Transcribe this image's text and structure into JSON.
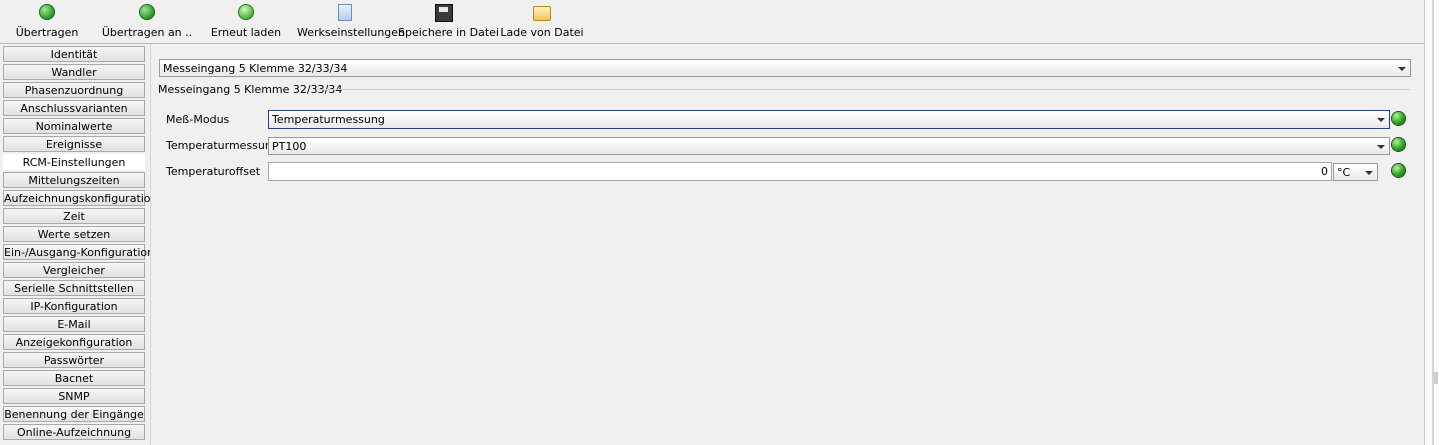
{
  "toolbar": {
    "buttons": [
      {
        "label": "Übertragen",
        "icon": "transfer-icon"
      },
      {
        "label": "Übertragen an ..",
        "icon": "transfer-to-icon"
      },
      {
        "label": "Erneut laden",
        "icon": "reload-icon"
      },
      {
        "label": "Werkseinstellungen",
        "icon": "factory-settings-icon"
      },
      {
        "label": "Speichere in Datei",
        "icon": "save-file-icon"
      },
      {
        "label": "Lade von Datei",
        "icon": "open-folder-icon"
      }
    ]
  },
  "sidebar": {
    "items": [
      {
        "label": "Identität"
      },
      {
        "label": "Wandler"
      },
      {
        "label": "Phasenzuordnung"
      },
      {
        "label": "Anschlussvarianten"
      },
      {
        "label": "Nominalwerte"
      },
      {
        "label": "Ereignisse"
      },
      {
        "label": "RCM-Einstellungen"
      },
      {
        "label": "Mittelungszeiten"
      },
      {
        "label": "Aufzeichnungskonfiguration"
      },
      {
        "label": "Zeit"
      },
      {
        "label": "Werte setzen"
      },
      {
        "label": "Ein-/Ausgang-Konfiguration"
      },
      {
        "label": "Vergleicher"
      },
      {
        "label": "Serielle Schnittstellen"
      },
      {
        "label": "IP-Konfiguration"
      },
      {
        "label": "E-Mail"
      },
      {
        "label": "Anzeigekonfiguration"
      },
      {
        "label": "Passwörter"
      },
      {
        "label": "Bacnet"
      },
      {
        "label": "SNMP"
      },
      {
        "label": "Benennung der Eingänge"
      },
      {
        "label": "Online-Aufzeichnung"
      }
    ],
    "active_index": 6
  },
  "main": {
    "input_selector": {
      "value": "Messeingang 5 Klemme 32/33/34"
    },
    "group_title": "Messeingang 5 Klemme 32/33/34",
    "fields": {
      "mode": {
        "label": "Meß-Modus",
        "value": "Temperaturmessung"
      },
      "sensor": {
        "label": "Temperaturmessung",
        "value": "PT100"
      },
      "offset": {
        "label": "Temperaturoffset",
        "value": "0",
        "unit": "°C"
      }
    },
    "status_color": "#2aa21c"
  }
}
